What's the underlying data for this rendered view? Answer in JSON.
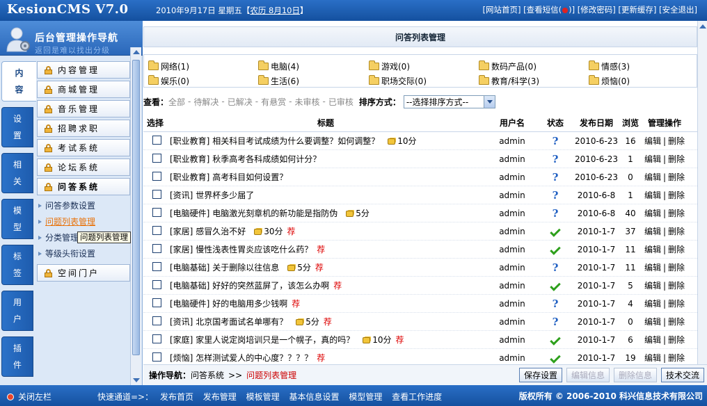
{
  "header": {
    "logo": "KesionCMS V7.0",
    "date_prefix": "2010年9月17日 星期五【",
    "lunar": "农历 8月10日",
    "date_suffix": "】",
    "links": {
      "home": "[网站首页]",
      "msg_pre": "[查看短信(",
      "msg_post": ")]",
      "password": "[修改密码]",
      "cache": "[更新缓存]",
      "logout": "[安全退出]"
    }
  },
  "nav": {
    "title": "后台管理操作导航",
    "title_ghost": "返回是难以找出分级",
    "tabs": [
      {
        "line1": "内",
        "line2": "容"
      },
      {
        "line1": "设",
        "line2": "置"
      },
      {
        "line1": "相",
        "line2": "关"
      },
      {
        "line1": "模",
        "line2": "型"
      },
      {
        "line1": "标",
        "line2": "签"
      },
      {
        "line1": "用",
        "line2": "户"
      },
      {
        "line1": "插",
        "line2": "件"
      }
    ],
    "menu": [
      "内容管理",
      "商城管理",
      "音乐管理",
      "招聘求职",
      "考试系统",
      "论坛系统",
      "问答系统"
    ],
    "submenu": [
      "问答参数设置",
      "问题列表管理",
      "分类管理",
      "等级头衔设置"
    ],
    "tooltip": "问题列表管理",
    "menu_after": "空间门户"
  },
  "main": {
    "title": "问答列表管理",
    "categories": [
      [
        "网络(1)",
        "电脑(4)",
        "游戏(0)",
        "数码产品(0)",
        "情感(3)"
      ],
      [
        "娱乐(0)",
        "生活(6)",
        "职场交际(0)",
        "教育/科学(3)",
        "烦恼(0)"
      ]
    ],
    "filter": {
      "label": "查看：",
      "options": [
        "全部",
        "待解决",
        "已解决",
        "有悬赏",
        "未审核",
        "已审核"
      ],
      "sort_label": "排序方式：",
      "sort_value": "--选择排序方式--"
    },
    "columns": {
      "select": "选择",
      "title": "标题",
      "user": "用户名",
      "status": "状态",
      "date": "发布日期",
      "views": "浏览",
      "ops": "管理操作"
    },
    "op_edit": "编辑",
    "op_sep": "|",
    "op_delete": "删除",
    "rows": [
      {
        "cat": "[职业教育]",
        "title": "相关科目考试成绩为什么要调整？如何调整？",
        "reward": "10分",
        "rec": "",
        "user": "admin",
        "status": "pending",
        "date": "2010-6-23",
        "views": "16"
      },
      {
        "cat": "[职业教育]",
        "title": "秋季高考各科成绩如何计分？",
        "reward": "",
        "rec": "",
        "user": "admin",
        "status": "pending",
        "date": "2010-6-23",
        "views": "1"
      },
      {
        "cat": "[职业教育]",
        "title": "高考科目如何设置？",
        "reward": "",
        "rec": "",
        "user": "admin",
        "status": "pending",
        "date": "2010-6-23",
        "views": "0"
      },
      {
        "cat": "[资讯]",
        "title": "世界杯多少届了",
        "reward": "",
        "rec": "",
        "user": "admin",
        "status": "pending",
        "date": "2010-6-8",
        "views": "1"
      },
      {
        "cat": "[电脑硬件]",
        "title": "电脑激光刻章机的新功能是指防伪",
        "reward": "5分",
        "rec": "",
        "user": "admin",
        "status": "pending",
        "date": "2010-6-8",
        "views": "40"
      },
      {
        "cat": "[家居]",
        "title": "感冒久治不好",
        "reward": "30分",
        "rec": "荐",
        "user": "admin",
        "status": "solved",
        "date": "2010-1-7",
        "views": "37"
      },
      {
        "cat": "[家居]",
        "title": "慢性浅表性胃炎应该吃什么药？",
        "reward": "",
        "rec": "荐",
        "user": "admin",
        "status": "solved",
        "date": "2010-1-7",
        "views": "11"
      },
      {
        "cat": "[电脑基础]",
        "title": "关于删除以往信息",
        "reward": "5分",
        "rec": "荐",
        "user": "admin",
        "status": "pending",
        "date": "2010-1-7",
        "views": "11"
      },
      {
        "cat": "[电脑基础]",
        "title": "好好的突然蓝屏了，该怎么办啊",
        "reward": "",
        "rec": "荐",
        "user": "admin",
        "status": "solved",
        "date": "2010-1-7",
        "views": "5"
      },
      {
        "cat": "[电脑硬件]",
        "title": "好的电脑用多少钱啊",
        "reward": "",
        "rec": "荐",
        "user": "admin",
        "status": "pending",
        "date": "2010-1-7",
        "views": "4"
      },
      {
        "cat": "[资讯]",
        "title": "北京国考面试名单哪有？",
        "reward": "5分",
        "rec": "荐",
        "user": "admin",
        "status": "pending",
        "date": "2010-1-7",
        "views": "0"
      },
      {
        "cat": "[家庭]",
        "title": "家里人说定岗培训只是一个幌子，真的吗？",
        "reward": "10分",
        "rec": "荐",
        "user": "admin",
        "status": "solved",
        "date": "2010-1-7",
        "views": "6"
      },
      {
        "cat": "[烦恼]",
        "title": "怎样测试爱人的中心度？？？？",
        "reward": "",
        "rec": "荐",
        "user": "admin",
        "status": "solved",
        "date": "2010-1-7",
        "views": "19"
      }
    ],
    "opnav": {
      "label": "操作导航：",
      "system": "问答系统",
      "sep": ">>",
      "current": "问题列表管理"
    },
    "buttons": {
      "save": "保存设置",
      "edit": "编辑信息",
      "delete": "删除信息",
      "support": "技术交流"
    }
  },
  "footer": {
    "close_left": "关闭左栏",
    "quick_label": "快速通道=>：",
    "quick_links": [
      "发布首页",
      "发布管理",
      "模板管理",
      "基本信息设置",
      "模型管理",
      "查看工作进度"
    ],
    "copyright": "版权所有 © 2006-2010 科兴信息技术有限公司"
  },
  "colors": {
    "accent": "#1f5fc2",
    "recommend": "#dd0000",
    "current_link": "#e8730c"
  }
}
